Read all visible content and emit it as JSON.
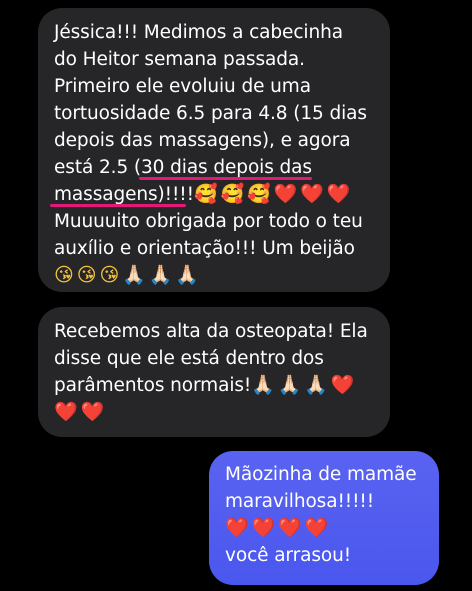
{
  "conversation": {
    "messages": [
      {
        "direction": "incoming",
        "lines": [
          "Jéssica!!! Medimos a cabecinha",
          "do Heitor semana passada.",
          "Primeiro ele evoluiu de uma",
          "tortuosidade 6.5 para 4.8 (15 dias",
          "depois das massagens), e agora",
          "está 2.5 (",
          "30 dias depois das",
          "massagens)!!!!",
          "Muuuuito obrigada por todo o teu",
          "auxílio e orientação!!! Um beijão"
        ],
        "emojis_line8": [
          "🥰",
          "🥰",
          "🥰",
          "❤️",
          "❤️",
          "❤️"
        ],
        "emojis_line11": [
          "😘",
          "😘",
          "😘",
          "🙏🏻",
          "🙏🏻",
          "🙏🏻"
        ]
      },
      {
        "direction": "incoming",
        "lines": [
          "Recebemos alta da osteopata! Ela",
          "disse que ele está dentro dos",
          "parâmentos normais!"
        ],
        "emojis_line3": [
          "🙏🏻",
          "🙏🏻",
          "🙏🏻",
          "❤️"
        ],
        "emojis_line4": [
          "❤️",
          "❤️"
        ]
      },
      {
        "direction": "outgoing",
        "lines": [
          "Mãozinha de mamãe",
          "maravilhosa!!!!!",
          "você arrasou!"
        ],
        "emojis_line3": [
          "❤️",
          "❤️",
          "❤️",
          "❤️"
        ]
      }
    ]
  },
  "colors": {
    "incoming_bubble": "#262628",
    "outgoing_bubble": "#4a57ee",
    "highlight_underline": "#e3197a",
    "background": "#000000"
  }
}
